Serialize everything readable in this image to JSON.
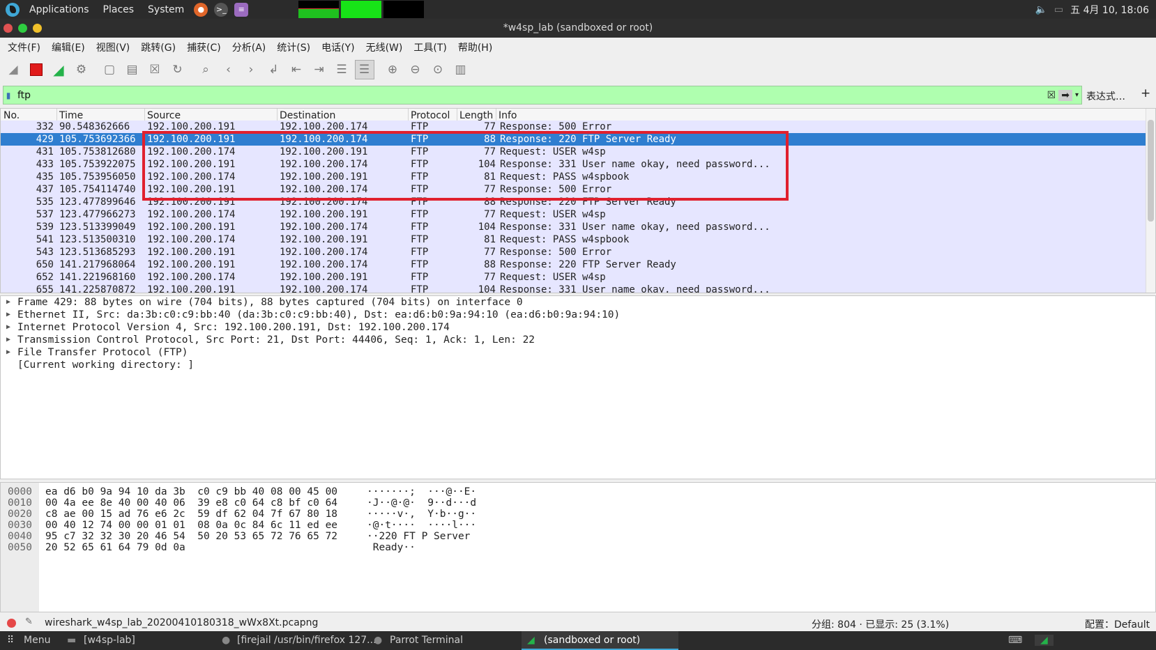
{
  "system_panel": {
    "applications": "Applications",
    "places": "Places",
    "system": "System",
    "datetime": "五 4月 10, 18:06",
    "cpu_graph_levels": [
      0.55,
      1.0,
      0.0
    ]
  },
  "window": {
    "title": "*w4sp_lab (sandboxed or root)"
  },
  "menubar": [
    "文件(F)",
    "编辑(E)",
    "视图(V)",
    "跳转(G)",
    "捕获(C)",
    "分析(A)",
    "统计(S)",
    "电话(Y)",
    "无线(W)",
    "工具(T)",
    "帮助(H)"
  ],
  "toolbar_icons": [
    "shark-fin-icon",
    "stop-capture-icon",
    "restart-capture-icon",
    "capture-options-icon",
    "open-file-icon",
    "save-file-icon",
    "close-file-icon",
    "reload-icon",
    "find-icon",
    "back-icon",
    "forward-icon",
    "go-to-packet-icon",
    "first-packet-icon",
    "last-packet-icon",
    "autoscroll-icon",
    "colorize-icon",
    "zoom-in-icon",
    "zoom-out-icon",
    "normal-size-icon",
    "resize-columns-icon"
  ],
  "filter": {
    "value": "ftp",
    "expression_label": "表达式…",
    "plus": "+"
  },
  "packet_list": {
    "columns": [
      "No.",
      "Time",
      "Source",
      "Destination",
      "Protocol",
      "Length",
      "Info"
    ],
    "rows": [
      {
        "no": "332",
        "time": "90.548362666",
        "src": "192.100.200.191",
        "dst": "192.100.200.174",
        "proto": "FTP",
        "len": "77",
        "info": "Response: 500 Error"
      },
      {
        "no": "429",
        "time": "105.753692366",
        "src": "192.100.200.191",
        "dst": "192.100.200.174",
        "proto": "FTP",
        "len": "88",
        "info": "Response: 220 FTP Server Ready"
      },
      {
        "no": "431",
        "time": "105.753812680",
        "src": "192.100.200.174",
        "dst": "192.100.200.191",
        "proto": "FTP",
        "len": "77",
        "info": "Request: USER w4sp"
      },
      {
        "no": "433",
        "time": "105.753922075",
        "src": "192.100.200.191",
        "dst": "192.100.200.174",
        "proto": "FTP",
        "len": "104",
        "info": "Response: 331 User name okay, need password..."
      },
      {
        "no": "435",
        "time": "105.753956050",
        "src": "192.100.200.174",
        "dst": "192.100.200.191",
        "proto": "FTP",
        "len": "81",
        "info": "Request: PASS w4spbook"
      },
      {
        "no": "437",
        "time": "105.754114740",
        "src": "192.100.200.191",
        "dst": "192.100.200.174",
        "proto": "FTP",
        "len": "77",
        "info": "Response: 500 Error"
      },
      {
        "no": "535",
        "time": "123.477899646",
        "src": "192.100.200.191",
        "dst": "192.100.200.174",
        "proto": "FTP",
        "len": "88",
        "info": "Response: 220 FTP Server Ready"
      },
      {
        "no": "537",
        "time": "123.477966273",
        "src": "192.100.200.174",
        "dst": "192.100.200.191",
        "proto": "FTP",
        "len": "77",
        "info": "Request: USER w4sp"
      },
      {
        "no": "539",
        "time": "123.513399049",
        "src": "192.100.200.191",
        "dst": "192.100.200.174",
        "proto": "FTP",
        "len": "104",
        "info": "Response: 331 User name okay, need password..."
      },
      {
        "no": "541",
        "time": "123.513500310",
        "src": "192.100.200.174",
        "dst": "192.100.200.191",
        "proto": "FTP",
        "len": "81",
        "info": "Request: PASS w4spbook"
      },
      {
        "no": "543",
        "time": "123.513685293",
        "src": "192.100.200.191",
        "dst": "192.100.200.174",
        "proto": "FTP",
        "len": "77",
        "info": "Response: 500 Error"
      },
      {
        "no": "650",
        "time": "141.217968064",
        "src": "192.100.200.191",
        "dst": "192.100.200.174",
        "proto": "FTP",
        "len": "88",
        "info": "Response: 220 FTP Server Ready"
      },
      {
        "no": "652",
        "time": "141.221968160",
        "src": "192.100.200.174",
        "dst": "192.100.200.191",
        "proto": "FTP",
        "len": "77",
        "info": "Request: USER w4sp"
      },
      {
        "no": "655",
        "time": "141.225870872",
        "src": "192.100.200.191",
        "dst": "192.100.200.174",
        "proto": "FTP",
        "len": "104",
        "info": "Response: 331 User name okay, need password..."
      }
    ]
  },
  "details": [
    "Frame 429: 88 bytes on wire (704 bits), 88 bytes captured (704 bits) on interface 0",
    "Ethernet II, Src: da:3b:c0:c9:bb:40 (da:3b:c0:c9:bb:40), Dst: ea:d6:b0:9a:94:10 (ea:d6:b0:9a:94:10)",
    "Internet Protocol Version 4, Src: 192.100.200.191, Dst: 192.100.200.174",
    "Transmission Control Protocol, Src Port: 21, Dst Port: 44406, Seq: 1, Ack: 1, Len: 22",
    "File Transfer Protocol (FTP)",
    "[Current working directory: ]"
  ],
  "bytes": [
    {
      "off": "0000",
      "hex": "ea d6 b0 9a 94 10 da 3b  c0 c9 bb 40 08 00 45 00",
      "asc": "·······;  ···@··E·"
    },
    {
      "off": "0010",
      "hex": "00 4a ee 8e 40 00 40 06  39 e8 c0 64 c8 bf c0 64",
      "asc": "·J··@·@·  9··d···d"
    },
    {
      "off": "0020",
      "hex": "c8 ae 00 15 ad 76 e6 2c  59 df 62 04 7f 67 80 18",
      "asc": "·····v·,  Y·b··g··"
    },
    {
      "off": "0030",
      "hex": "00 40 12 74 00 00 01 01  08 0a 0c 84 6c 11 ed ee",
      "asc": "·@·t····  ····l···"
    },
    {
      "off": "0040",
      "hex": "95 c7 32 32 30 20 46 54  50 20 53 65 72 76 65 72",
      "asc": "··220 FT P Server"
    },
    {
      "off": "0050",
      "hex": "20 52 65 61 64 79 0d 0a",
      "asc": " Ready··"
    }
  ],
  "status": {
    "file": "wireshark_w4sp_lab_20200410180318_wWx8Xt.pcapng",
    "packets": "分组: 804 · 已显示: 25 (3.1%)",
    "profile": "配置：Default"
  },
  "taskbar": {
    "menu": "Menu",
    "items": [
      "[w4sp-lab]",
      "[firejail /usr/bin/firefox 127...",
      "Parrot Terminal",
      "(sandboxed or root)"
    ]
  },
  "colors": {
    "selected": "#2f7ed0",
    "row_bg": "#e6e6ff",
    "filter_bg": "#afffaf",
    "highlight_box": "#e0202e"
  }
}
